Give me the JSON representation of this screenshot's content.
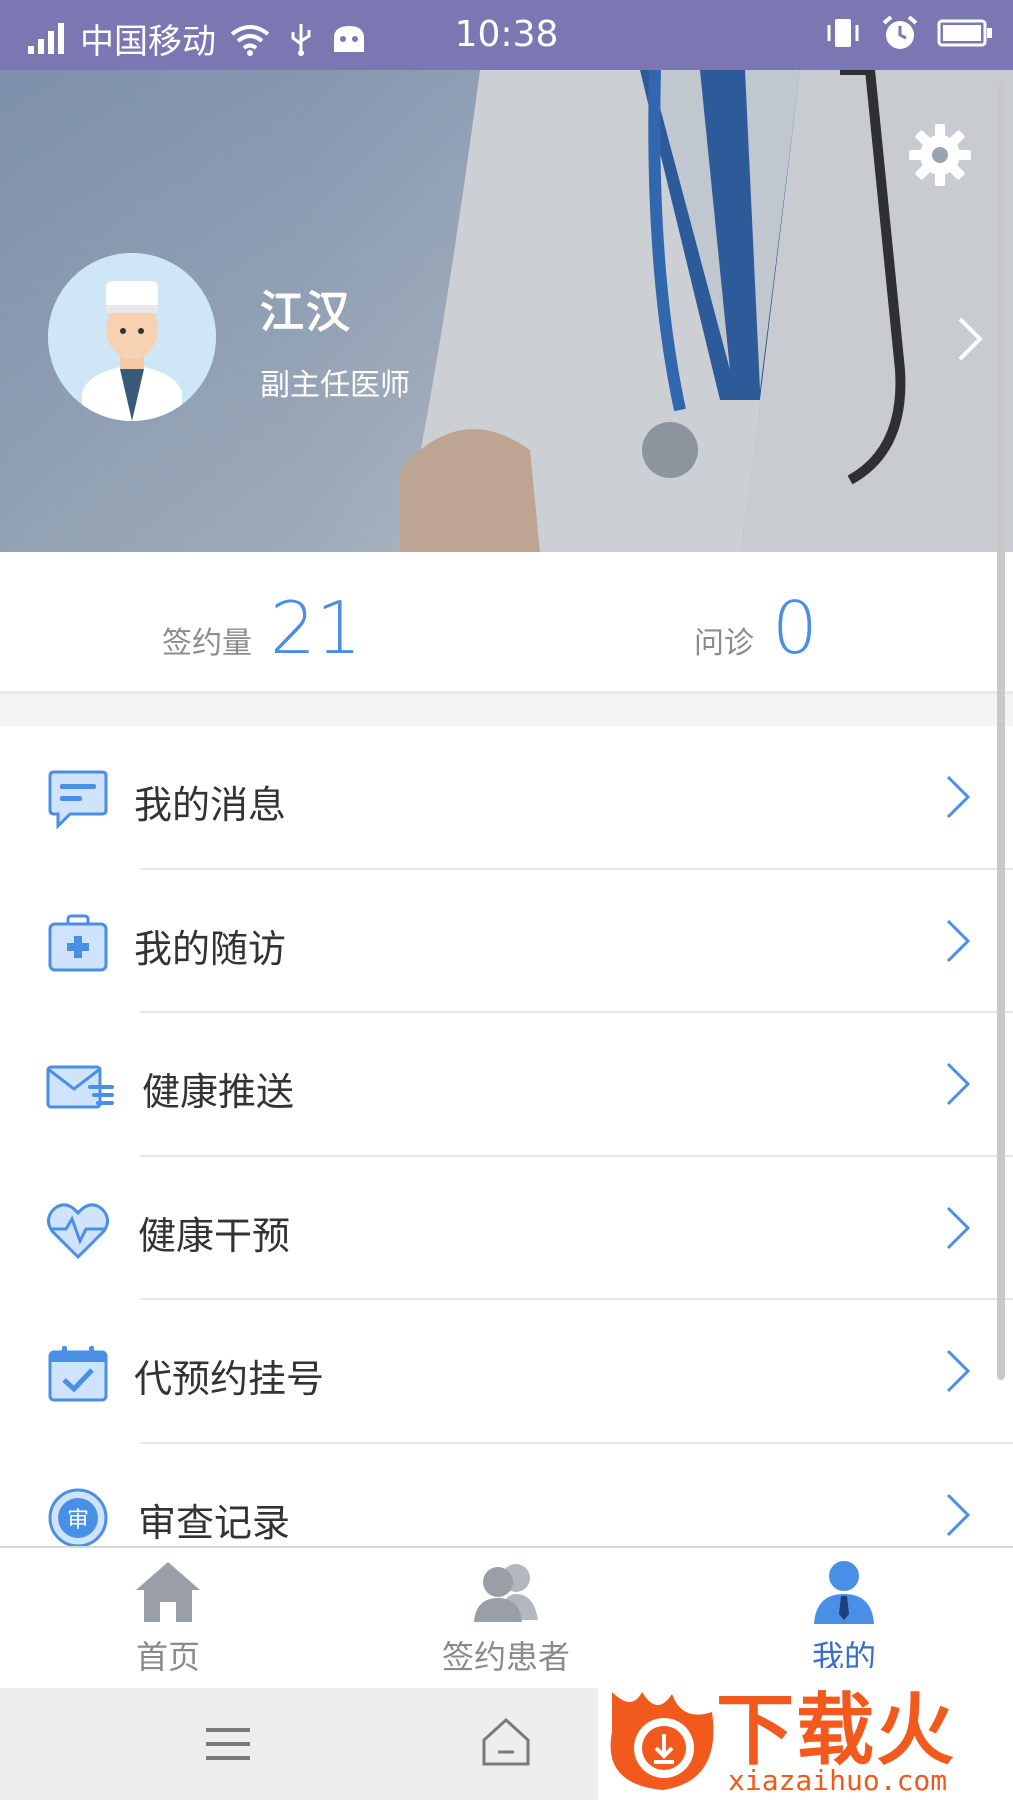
{
  "status_bar": {
    "carrier": "中国移动",
    "time": "10:38"
  },
  "profile": {
    "name": "江汉",
    "title": "副主任医师"
  },
  "stats": {
    "signed_label": "签约量",
    "signed_value": "21",
    "consult_label": "问诊",
    "consult_value": "0"
  },
  "menu": {
    "items": [
      {
        "label": "我的消息",
        "icon": "message-icon"
      },
      {
        "label": "我的随访",
        "icon": "medical-kit-icon"
      },
      {
        "label": "健康推送",
        "icon": "mail-send-icon"
      },
      {
        "label": "健康干预",
        "icon": "heart-pulse-icon"
      },
      {
        "label": "代预约挂号",
        "icon": "calendar-check-icon"
      },
      {
        "label": "审查记录",
        "icon": "review-stamp-icon",
        "icon_text": "审"
      }
    ]
  },
  "tabbar": {
    "tabs": [
      {
        "label": "首页",
        "icon": "home-icon",
        "active": false
      },
      {
        "label": "签约患者",
        "icon": "patients-icon",
        "active": false
      },
      {
        "label": "我的",
        "icon": "person-icon",
        "active": true
      }
    ]
  },
  "watermark": {
    "text": "下载火",
    "url": "xiazaihuo.com"
  },
  "colors": {
    "status_bar": "#7a77b3",
    "accent": "#4a8fe6",
    "tab_active": "#3a6ec9",
    "watermark": "#f25a1d"
  }
}
